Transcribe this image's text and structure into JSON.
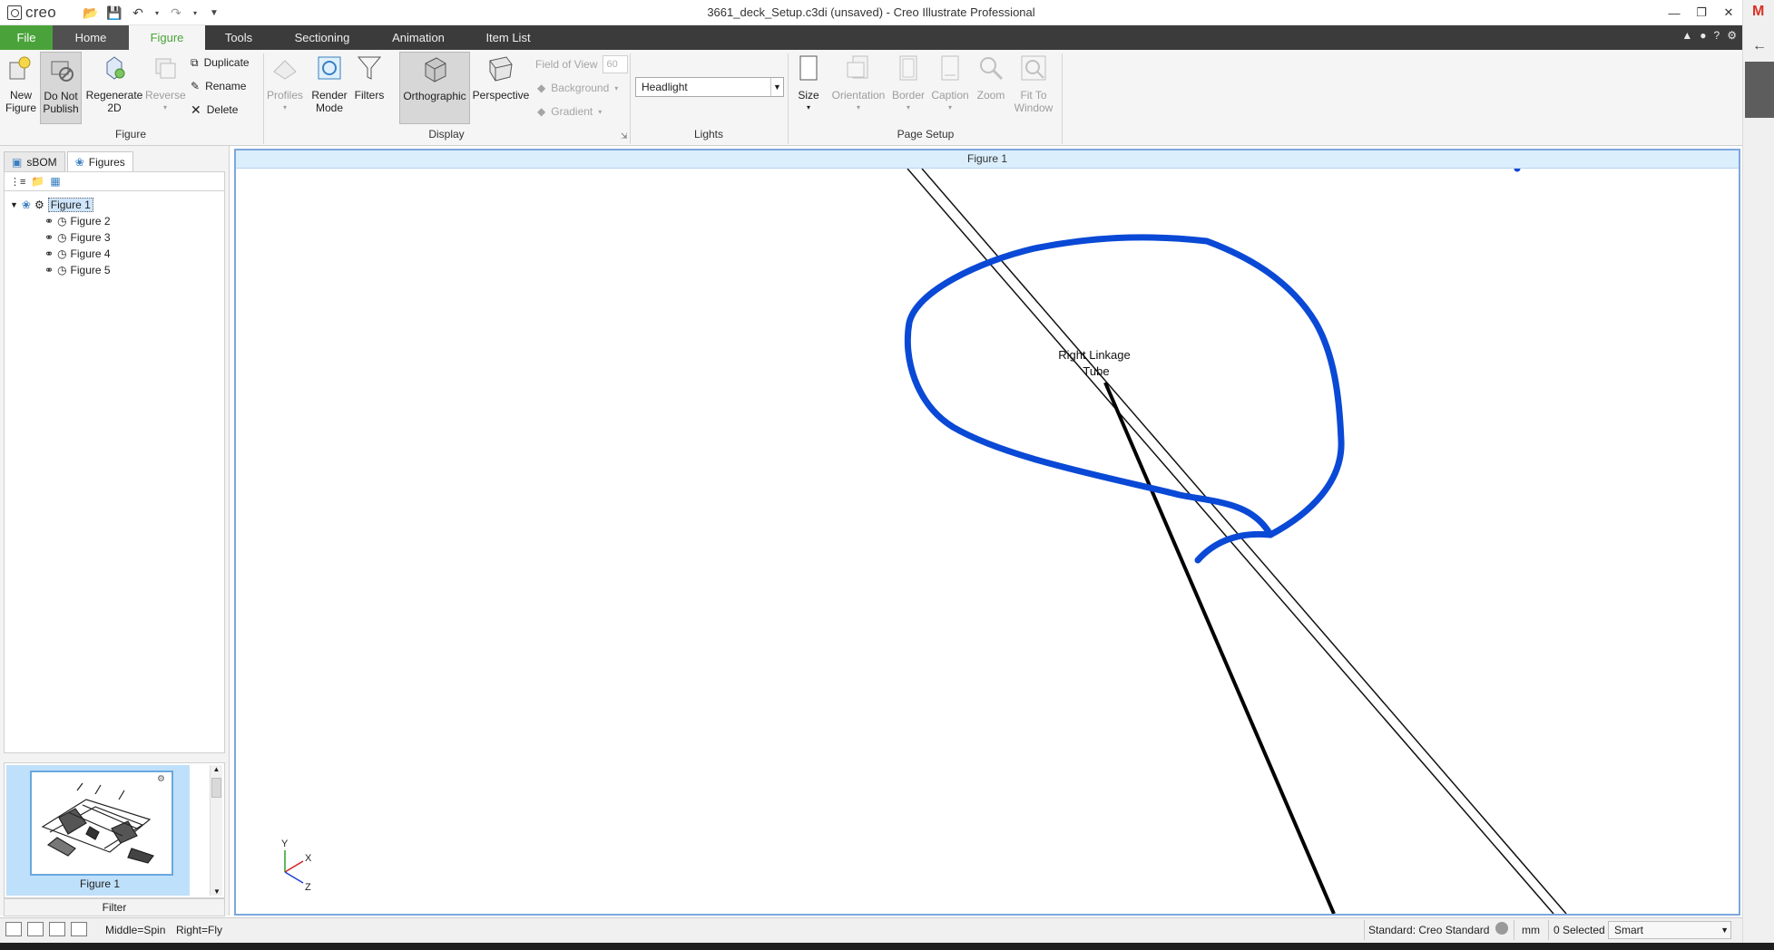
{
  "app": {
    "logo_text": "creo",
    "window_title": "3661_deck_Setup.c3di (unsaved) - Creo Illustrate Professional"
  },
  "menu": {
    "tabs": [
      "File",
      "Home",
      "Figure",
      "Tools",
      "Sectioning",
      "Animation",
      "Item List"
    ],
    "active": "Figure"
  },
  "ribbon": {
    "figure_group": {
      "label": "Figure",
      "new_figure": "New\nFigure",
      "do_not_publish": "Do Not\nPublish",
      "regenerate_2d": "Regenerate\n2D",
      "reverse": "Reverse",
      "duplicate": "Duplicate",
      "rename": "Rename",
      "delete": "Delete"
    },
    "display_group": {
      "label": "Display",
      "profiles": "Profiles",
      "render_mode": "Render\nMode",
      "filters": "Filters",
      "orthographic": "Orthographic",
      "perspective": "Perspective",
      "field_of_view": "Field of View",
      "field_of_view_value": "60",
      "background": "Background",
      "gradient": "Gradient"
    },
    "lights_group": {
      "label": "Lights",
      "selected": "Headlight"
    },
    "page_setup_group": {
      "label": "Page Setup",
      "size": "Size",
      "orientation": "Orientation",
      "border": "Border",
      "caption": "Caption",
      "zoom": "Zoom",
      "fit_to_window": "Fit To\nWindow"
    }
  },
  "left_panel": {
    "tabs": [
      "sBOM",
      "Figures"
    ],
    "active_tab": "Figures",
    "tree": [
      {
        "label": "Figure 1",
        "selected": true
      },
      {
        "label": "Figure 2",
        "selected": false
      },
      {
        "label": "Figure 3",
        "selected": false
      },
      {
        "label": "Figure 4",
        "selected": false
      },
      {
        "label": "Figure 5",
        "selected": false
      }
    ],
    "thumbnail_caption": "Figure 1",
    "filter_label": "Filter"
  },
  "canvas": {
    "title": "Figure 1",
    "callout_line1": "Right Linkage",
    "callout_line2": "Tube",
    "axis": {
      "y": "Y",
      "x": "X",
      "z": "Z"
    },
    "colors": {
      "annotation": "#0a49d6",
      "axis_x": "#d02020",
      "axis_y": "#2aa02a",
      "axis_z": "#2040d0"
    }
  },
  "status_bar": {
    "mouse_hint_middle": "Middle=Spin",
    "mouse_hint_right": "Right=Fly",
    "standard": "Standard: Creo Standard",
    "units": "mm",
    "selected_count": "0 Selected",
    "filter": "Smart"
  },
  "colors": {
    "accent_green": "#4aa33a",
    "menu_bg": "#3b3b3b"
  }
}
